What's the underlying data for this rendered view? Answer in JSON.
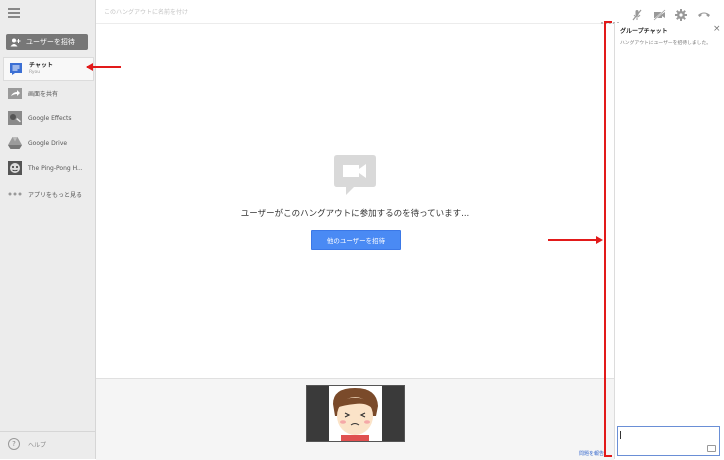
{
  "sidebar": {
    "invite_label": "ユーザーを招待",
    "items": [
      {
        "label": "チャット",
        "sublabel": "Ryou",
        "icon": "chat-icon"
      },
      {
        "label": "画面を共有",
        "icon": "screen-share-icon"
      },
      {
        "label": "Google Effects",
        "icon": "effects-icon"
      },
      {
        "label": "Google Drive",
        "icon": "drive-icon"
      },
      {
        "label": "The Ping-Pong H...",
        "icon": "ping-pong-app-icon"
      },
      {
        "label": "アプリをもっと見る",
        "icon": "more-dots-icon"
      }
    ],
    "help_label": "ヘルプ"
  },
  "topbar": {
    "title_placeholder": "このハングアウトに名前を付け",
    "icons": [
      "signal-dots-icon",
      "mic-off-icon",
      "camera-off-icon",
      "settings-icon",
      "hangup-icon"
    ]
  },
  "main": {
    "waiting_text": "ユーザーがこのハングアウトに参加するのを待っています...",
    "invite_others_label": "他のユーザーを招待"
  },
  "footer": {
    "report_link": "問題を報告"
  },
  "chat": {
    "title": "グループチャット",
    "message": "ハングアウトにユーザーを招待しました。",
    "close_glyph": "×"
  },
  "colors": {
    "accent_blue": "#4a8af4",
    "annotation_red": "#e21a1a"
  }
}
